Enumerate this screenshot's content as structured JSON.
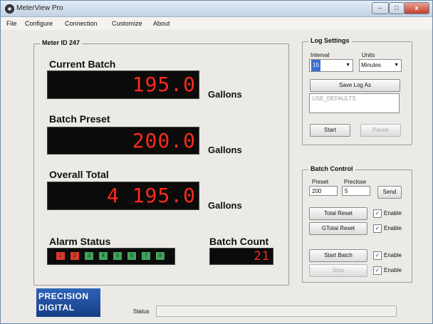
{
  "window": {
    "title": "MeterView Pro",
    "minimize": "–",
    "maximize": "□",
    "close": "x"
  },
  "menu": [
    "File",
    "Configure",
    "Connection",
    "Customize",
    "About"
  ],
  "meter": {
    "group_title": "Meter ID 247",
    "current_batch": {
      "label": "Current Batch",
      "value": "195.0",
      "unit": "Gallons"
    },
    "batch_preset": {
      "label": "Batch Preset",
      "value": "200.0",
      "unit": "Gallons"
    },
    "overall_total": {
      "label": "Overall Total",
      "value": "4 195.0",
      "unit": "Gallons"
    },
    "alarm_status": {
      "label": "Alarm Status",
      "alarms": [
        {
          "num": "1",
          "color": "#d83a2a"
        },
        {
          "num": "2",
          "color": "#d83a2a"
        },
        {
          "num": "3",
          "color": "#3fa35a"
        },
        {
          "num": "4",
          "color": "#3fa35a"
        },
        {
          "num": "5",
          "color": "#3fa35a"
        },
        {
          "num": "6",
          "color": "#3fa35a"
        },
        {
          "num": "7",
          "color": "#3fa35a"
        },
        {
          "num": "8",
          "color": "#3fa35a"
        }
      ]
    },
    "batch_count": {
      "label": "Batch Count",
      "value": "21"
    }
  },
  "log": {
    "group_title": "Log Settings",
    "interval_label": "Interval",
    "interval_value": "15",
    "units_label": "Units",
    "units_value": "Minutes",
    "save_button": "Save Log As",
    "file_name": "USE_DEFAULTS",
    "start_button": "Start",
    "pause_button": "Pause"
  },
  "batch_control": {
    "group_title": "Batch Control",
    "preset_label": "Preset",
    "preset_value": "200",
    "preclose_label": "Preclose",
    "preclose_value": "5",
    "send_button": "Send",
    "total_reset": "Total Reset",
    "gtotal_reset": "GTotal Reset",
    "start_batch": "Start Batch",
    "stop": "Stop",
    "enable_label": "Enable"
  },
  "logo": {
    "line1": "PRECISION",
    "line2": "DIGITAL"
  },
  "status": {
    "label": "Status"
  },
  "colors": {
    "lcd_digits": "#ff2a1a",
    "logo_blue": "#1f4f9f"
  }
}
